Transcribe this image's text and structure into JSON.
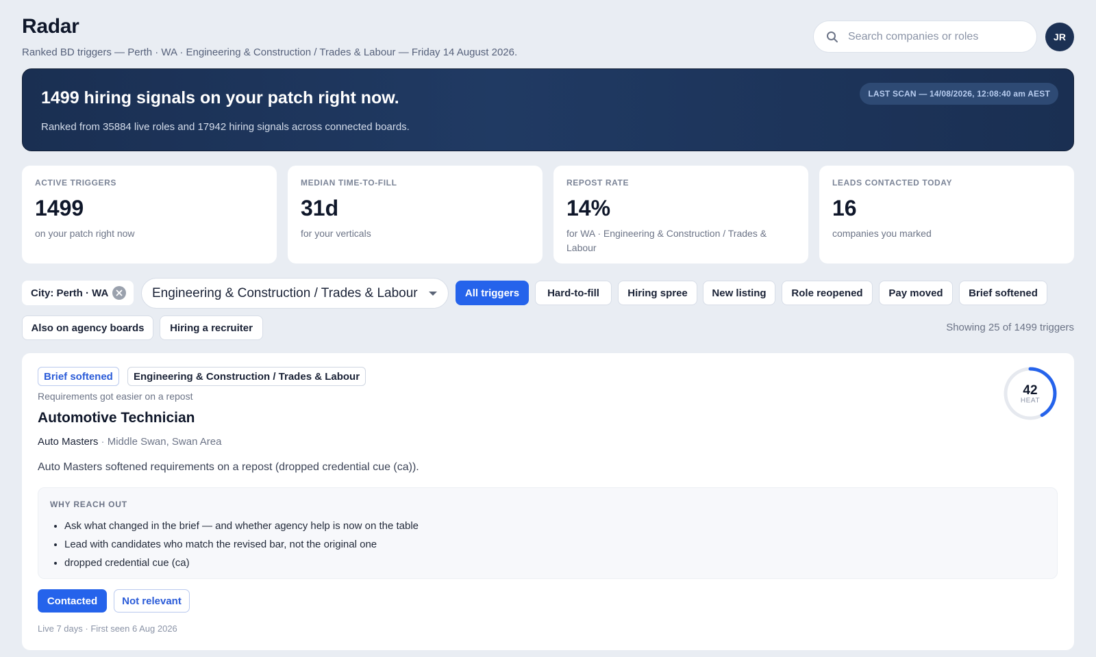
{
  "header": {
    "title": "Radar",
    "subtitle": "Ranked BD triggers — Perth · WA · Engineering & Construction / Trades & Labour — Friday 14 August 2026."
  },
  "search": {
    "placeholder": "Search companies or roles",
    "value": ""
  },
  "user": {
    "initials": "JR"
  },
  "banner": {
    "headline": "1499 hiring signals on your patch right now.",
    "detail": "Ranked from 35884 live roles and 17942 hiring signals across connected boards.",
    "last_scan": "LAST SCAN — 14/08/2026, 12:08:40 am AEST"
  },
  "stats": [
    {
      "label": "ACTIVE TRIGGERS",
      "value": "1499",
      "desc": "on your patch right now"
    },
    {
      "label": "MEDIAN TIME-TO-FILL",
      "value": "31d",
      "desc": "for your verticals"
    },
    {
      "label": "REPOST RATE",
      "value": "14%",
      "desc": "for WA · Engineering & Construction / Trades & Labour"
    },
    {
      "label": "LEADS CONTACTED TODAY",
      "value": "16",
      "desc": "companies you marked"
    }
  ],
  "filters": {
    "city": "City: Perth · WA",
    "vertical": "Engineering & Construction / Trades & Labour",
    "triggers": [
      "All triggers",
      "Hard-to-fill",
      "Hiring spree",
      "New listing",
      "Role reopened",
      "Pay moved",
      "Brief softened",
      "Also on agency boards",
      "Hiring a recruiter"
    ],
    "active_trigger": "All triggers",
    "showing": "Showing 25 of 1499 triggers"
  },
  "card": {
    "trigger_tag": "Brief softened",
    "vertical_tag": "Engineering & Construction / Trades & Labour",
    "tagline": "Requirements got easier on a repost",
    "role": "Automotive Technician",
    "company": "Auto Masters",
    "separator": " · ",
    "location": "Middle Swan, Swan Area",
    "summary": "Auto Masters softened requirements on a repost (dropped credential cue (ca)).",
    "heat_value": "42",
    "heat_label": "HEAT",
    "heat_fraction": 0.42,
    "why_title": "WHY REACH OUT",
    "why_points": [
      "Ask what changed in the brief — and whether agency help is now on the table",
      "Lead with candidates who match the revised bar, not the original one",
      "dropped credential cue (ca)"
    ],
    "actions": {
      "primary": "Contacted",
      "secondary": "Not relevant"
    },
    "footer": "Live 7 days · First seen 6 Aug 2026"
  },
  "colors": {
    "accent": "#2563eb",
    "banner": "#1c3154",
    "heat_track": "#e6e9ef"
  }
}
